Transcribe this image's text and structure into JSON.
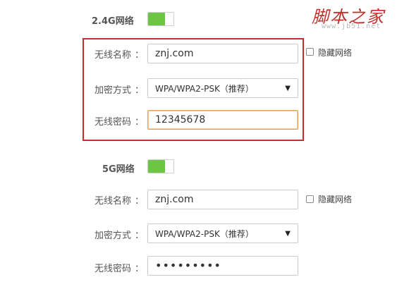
{
  "watermark": {
    "main": "脚本之家",
    "sub": "www.jb51.net"
  },
  "colors": {
    "toggle_on": "#6cc644",
    "highlight_border": "#c0302b",
    "focus_border": "#e8a25a"
  },
  "band_24g": {
    "title": "2.4G网络",
    "enabled": true,
    "ssid_label": "无线名称",
    "ssid_value": "znj.com",
    "hide_label": "隐藏网络",
    "hide_checked": false,
    "security_label": "加密方式",
    "security_value": "WPA/WPA2-PSK（推荐）",
    "password_label": "无线密码",
    "password_value": "12345678",
    "colon": "："
  },
  "band_5g": {
    "title": "5G网络",
    "enabled": true,
    "ssid_label": "无线名称",
    "ssid_value": "znj.com",
    "hide_label": "隐藏网络",
    "hide_checked": false,
    "security_label": "加密方式",
    "security_value": "WPA/WPA2-PSK（推荐）",
    "password_label": "无线密码",
    "password_value": "•••••••••",
    "colon": "："
  }
}
